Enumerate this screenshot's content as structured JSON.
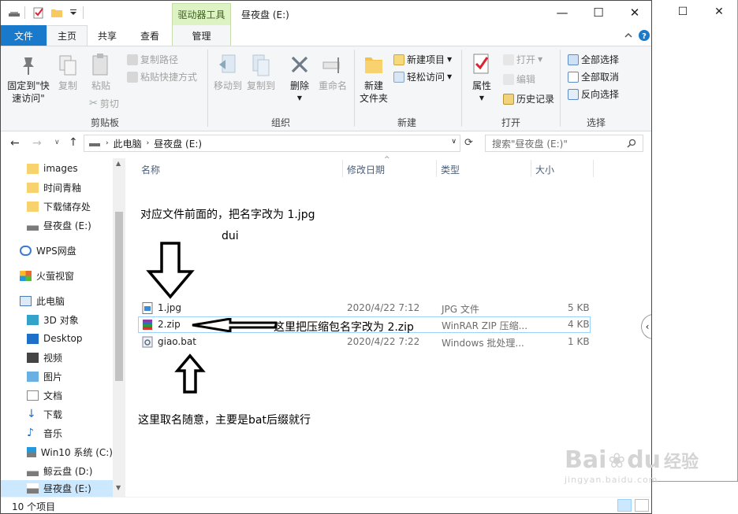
{
  "window": {
    "title": "昼夜盘 (E:)",
    "context_tab": "驱动器工具",
    "controls": {
      "minimize": "—",
      "maximize": "☐",
      "close": "✕"
    }
  },
  "background_window": {
    "maximize": "☐",
    "close": "✕"
  },
  "tabs": {
    "file": "文件",
    "home": "主页",
    "share": "共享",
    "view": "查看",
    "manage": "管理"
  },
  "ribbon": {
    "clipboard": {
      "label": "剪贴板",
      "pin": "固定到\"快",
      "pin2": "速访问\"",
      "copy": "复制",
      "paste": "粘贴",
      "copy_path": "复制路径",
      "paste_shortcut": "粘贴快捷方式",
      "cut": "剪切"
    },
    "organize": {
      "label": "组织",
      "move_to": "移动到",
      "copy_to": "复制到",
      "delete": "删除",
      "rename": "重命名"
    },
    "new": {
      "label": "新建",
      "new_folder": "新建",
      "new_folder2": "文件夹",
      "new_item": "新建项目",
      "easy_access": "轻松访问"
    },
    "open": {
      "label": "打开",
      "properties": "属性",
      "open": "打开",
      "edit": "编辑",
      "history": "历史记录"
    },
    "select": {
      "label": "选择",
      "select_all": "全部选择",
      "select_none": "全部取消",
      "invert": "反向选择"
    }
  },
  "address": {
    "crumb_pc": "此电脑",
    "crumb_drive": "昼夜盘 (E:)",
    "search_placeholder": "搜索\"昼夜盘 (E:)\""
  },
  "nav": {
    "items": [
      {
        "label": "images",
        "icon": "folder-icon"
      },
      {
        "label": "时间青釉",
        "icon": "folder-icon"
      },
      {
        "label": "下载储存处",
        "icon": "folder-icon"
      },
      {
        "label": "昼夜盘 (E:)",
        "icon": "drive-icon"
      },
      {
        "label": "WPS网盘",
        "icon": "cloud-icon"
      },
      {
        "label": "火萤视窗",
        "icon": "windows-icon"
      },
      {
        "label": "此电脑",
        "icon": "computer-icon"
      },
      {
        "label": "3D 对象",
        "icon": "cube-icon"
      },
      {
        "label": "Desktop",
        "icon": "desktop-icon"
      },
      {
        "label": "视频",
        "icon": "video-icon"
      },
      {
        "label": "图片",
        "icon": "picture-icon"
      },
      {
        "label": "文档",
        "icon": "document-icon"
      },
      {
        "label": "下载",
        "icon": "download-icon"
      },
      {
        "label": "音乐",
        "icon": "music-icon"
      },
      {
        "label": "Win10 系统 (C:)",
        "icon": "drive-icon"
      },
      {
        "label": "鲸云盘 (D:)",
        "icon": "drive-icon"
      },
      {
        "label": "昼夜盘 (E:)",
        "icon": "drive-icon"
      }
    ]
  },
  "columns": {
    "name": "名称",
    "modified": "修改日期",
    "type": "类型",
    "size": "大小"
  },
  "files": [
    {
      "name": "1.jpg",
      "date": "2020/4/22 7:12",
      "type": "JPG 文件",
      "size": "5 KB"
    },
    {
      "name": "2.zip",
      "date": "",
      "type": "WinRAR ZIP 压缩...",
      "size": "4 KB"
    },
    {
      "name": "giao.bat",
      "date": "2020/4/22 7:22",
      "type": "Windows 批处理...",
      "size": "1 KB"
    }
  ],
  "annotations": {
    "top_note": "对应文件前面的，把名字改为 1.jpg",
    "dui": "dui",
    "zip_note": "这里把压缩包名字改为 2.zip",
    "bat_note": "这里取名随意，主要是bat后缀就行"
  },
  "status": {
    "count": "10 个项目"
  },
  "watermark": {
    "brand": "Bai",
    "brand2": "du",
    "cn": "经验",
    "url": "jingyan.baidu.com"
  }
}
